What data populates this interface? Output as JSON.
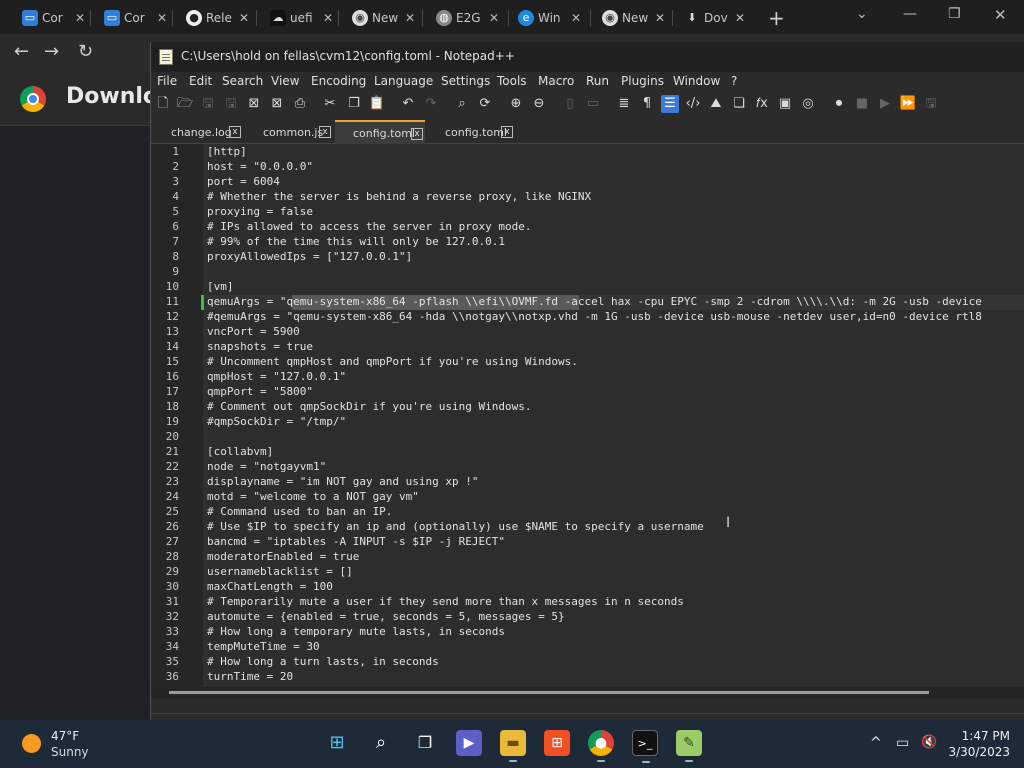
{
  "browser": {
    "tabs": [
      {
        "label": "Cor",
        "icon": "monitor-icon"
      },
      {
        "label": "Cor",
        "icon": "monitor-icon"
      },
      {
        "label": "Rele",
        "icon": "github-icon"
      },
      {
        "label": "uefi",
        "icon": "cloud-icon"
      },
      {
        "label": "New",
        "icon": "chrome-icon"
      },
      {
        "label": "E2G",
        "icon": "globe-icon"
      },
      {
        "label": "Win",
        "icon": "edge-icon"
      },
      {
        "label": "New",
        "icon": "chrome-icon"
      },
      {
        "label": "Dov",
        "icon": "download-icon"
      }
    ],
    "close_glyph": "✕",
    "new_tab": "+",
    "page_title": "Downloa",
    "nav": {
      "back": "←",
      "forward": "→",
      "reload": "↻"
    },
    "window_controls": {
      "chevron": "⌄",
      "minimize": "—",
      "maximize": "❐",
      "close": "✕"
    }
  },
  "notepad": {
    "title": "C:\\Users\\hold on fellas\\cvm12\\config.toml - Notepad++",
    "menu": [
      "File",
      "Edit",
      "Search",
      "View",
      "Encoding",
      "Language",
      "Settings",
      "Tools",
      "Macro",
      "Run",
      "Plugins",
      "Window",
      "?"
    ],
    "file_tabs": [
      {
        "label": "change.log",
        "active": false
      },
      {
        "label": "common.js",
        "active": false
      },
      {
        "label": "config.toml",
        "active": true
      },
      {
        "label": "config.toml",
        "active": false
      }
    ],
    "tab_close": "x",
    "current_line": 11,
    "lines": [
      "[http]",
      "host = \"0.0.0.0\"",
      "port = 6004",
      "# Whether the server is behind a reverse proxy, like NGINX",
      "proxying = false",
      "# IPs allowed to access the server in proxy mode.",
      "# 99% of the time this will only be 127.0.0.1",
      "proxyAllowedIps = [\"127.0.0.1\"]",
      "",
      "[vm]",
      "qemuArgs = \"qemu-system-x86_64 -pflash \\\\efi\\\\OVMF.fd -accel hax -cpu EPYC -smp 2 -cdrom \\\\\\\\.\\\\d: -m 2G -usb -device",
      "#qemuArgs = \"qemu-system-x86_64 -hda \\\\notgay\\\\notxp.vhd -m 1G -usb -device usb-mouse -netdev user,id=n0 -device rtl8",
      "vncPort = 5900",
      "snapshots = true",
      "# Uncomment qmpHost and qmpPort if you're using Windows.",
      "qmpHost = \"127.0.0.1\"",
      "qmpPort = \"5800\"",
      "# Comment out qmpSockDir if you're using Windows.",
      "#qmpSockDir = \"/tmp/\"",
      "",
      "[collabvm]",
      "node = \"notgayvm1\"",
      "displayname = \"im NOT gay and using xp !\"",
      "motd = \"welcome to a NOT gay vm\"",
      "# Command used to ban an IP.",
      "# Use $IP to specify an ip and (optionally) use $NAME to specify a username",
      "bancmd = \"iptables -A INPUT -s $IP -j REJECT\"",
      "moderatorEnabled = true",
      "usernameblacklist = []",
      "maxChatLength = 100",
      "# Temporarily mute a user if they send more than x messages in n seconds",
      "automute = {enabled = true, seconds = 5, messages = 5}",
      "# How long a temporary mute lasts, in seconds",
      "tempMuteTime = 30",
      "# How long a turn lasts, in seconds",
      "turnTime = 20"
    ]
  },
  "taskbar": {
    "temperature": "47°F",
    "condition": "Sunny",
    "time": "1:47 PM",
    "date": "3/30/2023",
    "apps": [
      "windows-start-icon",
      "search-icon",
      "task-view-icon",
      "teams-chat-icon",
      "file-explorer-icon",
      "microsoft-store-icon",
      "chrome-icon",
      "terminal-icon",
      "notepadpp-icon"
    ],
    "tray": {
      "chevron": "^",
      "network": "▭",
      "volume": "🔇"
    }
  },
  "colors": {
    "accent": "#3a7bd5",
    "tab_highlight": "#f0a030",
    "taskbar": "#1e2a38"
  }
}
